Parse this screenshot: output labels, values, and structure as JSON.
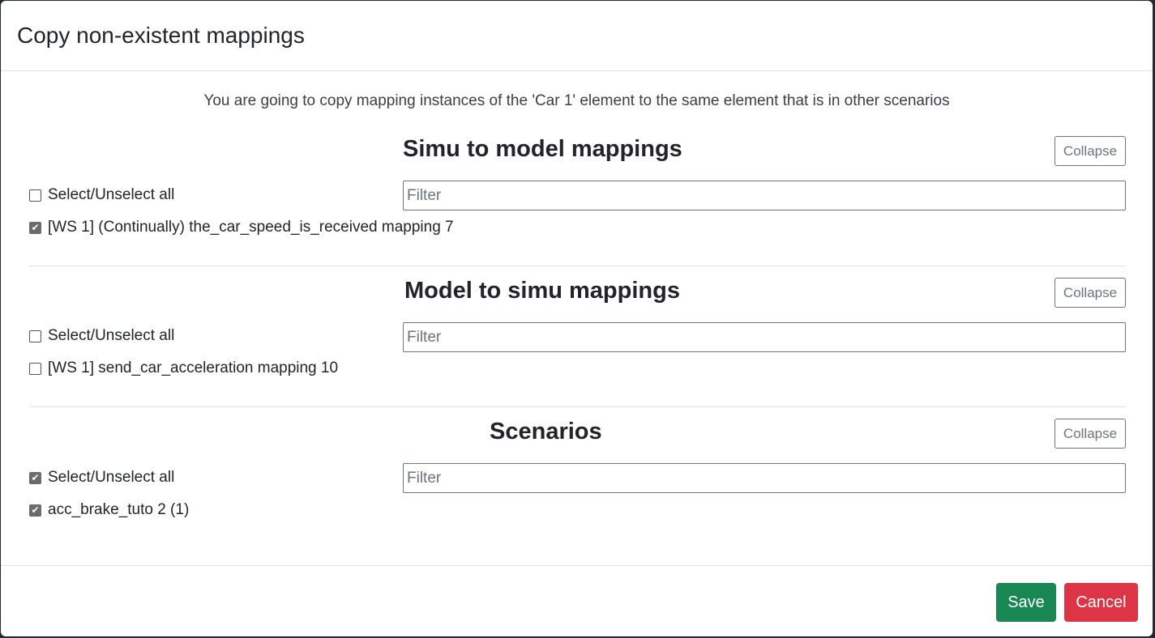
{
  "modal": {
    "title": "Copy non-existent mappings",
    "intro": "You are going to copy mapping instances of the 'Car 1' element to the same element that is in other scenarios"
  },
  "sections": [
    {
      "title": "Simu to model mappings",
      "collapse_label": "Collapse",
      "filter_placeholder": "Filter",
      "select_all": {
        "label": "Select/Unselect all",
        "checked": false
      },
      "items": [
        {
          "label": "[WS 1] (Continually) the_car_speed_is_received mapping 7",
          "checked": true
        }
      ]
    },
    {
      "title": "Model to simu mappings",
      "collapse_label": "Collapse",
      "filter_placeholder": "Filter",
      "select_all": {
        "label": "Select/Unselect all",
        "checked": false
      },
      "items": [
        {
          "label": "[WS 1] send_car_acceleration mapping 10",
          "checked": false
        }
      ]
    },
    {
      "title": "Scenarios",
      "collapse_label": "Collapse",
      "filter_placeholder": "Filter",
      "select_all": {
        "label": "Select/Unselect all",
        "checked": true
      },
      "items": [
        {
          "label": "acc_brake_tuto 2 (1)",
          "checked": true
        }
      ]
    }
  ],
  "footer": {
    "save_label": "Save",
    "cancel_label": "Cancel"
  },
  "colors": {
    "save": "#198754",
    "cancel": "#dc3545",
    "secondary": "#6c757d"
  }
}
